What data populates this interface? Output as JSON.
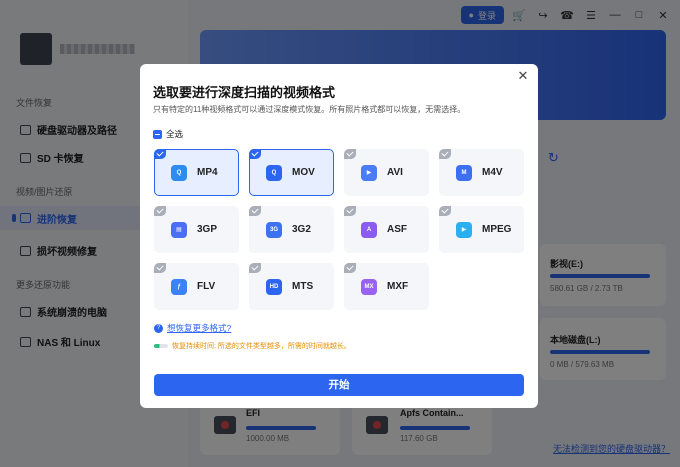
{
  "topbar": {
    "login_label": "登录"
  },
  "sidebar": {
    "sections": [
      {
        "title": "文件恢复",
        "items": [
          "硬盘驱动器及路径",
          "SD 卡恢复"
        ]
      },
      {
        "title": "视频/图片还原",
        "items": [
          "进阶恢复",
          "损坏视频修复"
        ]
      },
      {
        "title": "更多还原功能",
        "items": [
          "系统崩溃的电脑",
          "NAS 和 Linux"
        ]
      }
    ],
    "active_item": "进阶恢复"
  },
  "disks": [
    {
      "name": "影视(E:)",
      "size": "580.61 GB / 2.73 TB"
    },
    {
      "name": "本地磁盘(L:)",
      "size": "0 MB / 579.63 MB"
    },
    {
      "name": "EFI",
      "size": "1000.00 MB"
    },
    {
      "name": "Apfs Contain...",
      "size": "117.60 GB"
    }
  ],
  "footer_link": "无法检测到您的硬盘驱动器？",
  "modal": {
    "title": "选取要进行深度扫描的视频格式",
    "subtitle": "只有特定的11种视频格式可以通过深度模式恢复。所有照片格式都可以恢复，无需选择。",
    "select_all": "全选",
    "formats": [
      {
        "label": "MP4",
        "selected": true,
        "icon": "quicktime-icon",
        "color": "#2c8cf0"
      },
      {
        "label": "MOV",
        "selected": true,
        "icon": "quicktime-icon",
        "color": "#2c66f0"
      },
      {
        "label": "AVI",
        "selected": false,
        "icon": "clapper-icon",
        "color": "#4a7cf5"
      },
      {
        "label": "M4V",
        "selected": false,
        "icon": "m4v-icon",
        "color": "#3d6ff2"
      },
      {
        "label": "3GP",
        "selected": false,
        "icon": "file-icon",
        "color": "#4b6ff3"
      },
      {
        "label": "3G2",
        "selected": false,
        "icon": "file-3g2-icon",
        "color": "#3d72f5"
      },
      {
        "label": "ASF",
        "selected": false,
        "icon": "asf-icon",
        "color": "#8a5cf0"
      },
      {
        "label": "MPEG",
        "selected": false,
        "icon": "play-icon",
        "color": "#2ab0f0"
      },
      {
        "label": "FLV",
        "selected": false,
        "icon": "flash-icon",
        "color": "#3b82f6"
      },
      {
        "label": "MTS",
        "selected": false,
        "icon": "hd-icon",
        "color": "#2c66f0"
      },
      {
        "label": "MXF",
        "selected": false,
        "icon": "mxf-icon",
        "color": "#9a62f2"
      }
    ],
    "more_link": "想恢复更多格式?",
    "warning": "恢复持续时间: 所选的文件类型越多，所需的时间就越长。",
    "start_label": "开始",
    "colors": {
      "accent": "#2c66f0",
      "warning": "#e88b00"
    }
  }
}
